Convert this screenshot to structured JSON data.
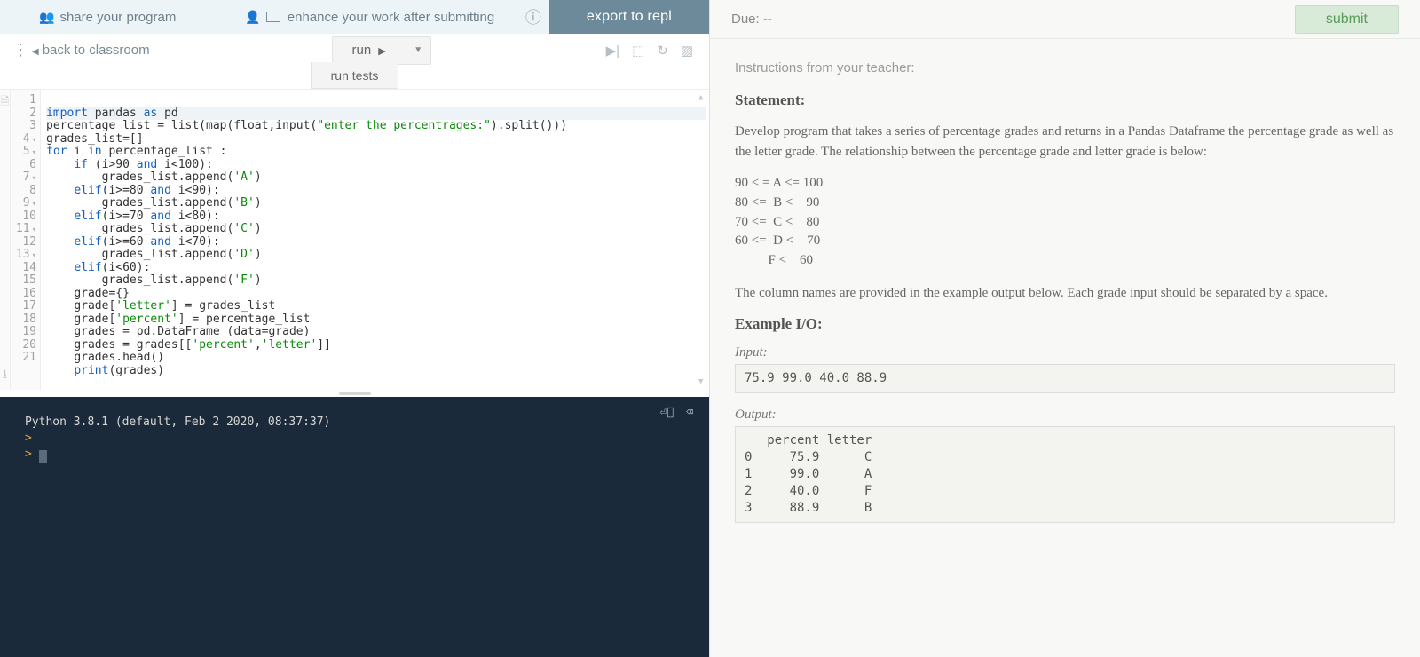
{
  "topstrip": {
    "share": "share your program",
    "enhance": "enhance your work after submitting",
    "export": "export to repl"
  },
  "toolbar": {
    "back": "back to classroom",
    "run": "run",
    "runtests": "run tests"
  },
  "editor": {
    "lines": [
      {
        "n": "1"
      },
      {
        "n": "2"
      },
      {
        "n": "3"
      },
      {
        "n": "4",
        "f": true
      },
      {
        "n": "5",
        "f": true
      },
      {
        "n": "6"
      },
      {
        "n": "7",
        "f": true
      },
      {
        "n": "8"
      },
      {
        "n": "9",
        "f": true
      },
      {
        "n": "10"
      },
      {
        "n": "11",
        "f": true
      },
      {
        "n": "12"
      },
      {
        "n": "13",
        "f": true
      },
      {
        "n": "14"
      },
      {
        "n": "15"
      },
      {
        "n": "16"
      },
      {
        "n": "17"
      },
      {
        "n": "18"
      },
      {
        "n": "19"
      },
      {
        "n": "20"
      },
      {
        "n": "21"
      }
    ]
  },
  "code_tokens": {
    "l1_import": "import",
    "l1_pandas": " pandas ",
    "l1_as": "as",
    "l1_pd": " pd",
    "l2": "percentage_list = list(map(float,input(",
    "l2_str": "\"enter the percentrages:\"",
    "l2_end": ").split()))",
    "l3": "grades_list=[]",
    "l4_for": "for",
    "l4_mid": " i ",
    "l4_in": "in",
    "l4_end": " percentage_list :",
    "l5_if": "if",
    "l5_mid": " (i>90 ",
    "l5_and": "and",
    "l5_end": " i<100):",
    "l6_a": "        grades_list.append(",
    "l6_str": "'A'",
    "l6_b": ")",
    "l7_elif": "elif",
    "l7_mid": "(i>=80 ",
    "l7_and": "and",
    "l7_end": " i<90):",
    "l8_a": "        grades_list.append(",
    "l8_str": "'B'",
    "l8_b": ")",
    "l9_elif": "elif",
    "l9_mid": "(i>=70 ",
    "l9_and": "and",
    "l9_end": " i<80):",
    "l10_a": "        grades_list.append(",
    "l10_str": "'C'",
    "l10_b": ")",
    "l11_elif": "elif",
    "l11_mid": "(i>=60 ",
    "l11_and": "and",
    "l11_end": " i<70):",
    "l12_a": "        grades_list.append(",
    "l12_str": "'D'",
    "l12_b": ")",
    "l13_elif": "elif",
    "l13_end": "(i<60):",
    "l14_a": "        grades_list.append(",
    "l14_str": "'F'",
    "l14_b": ")",
    "l15": "grade={}",
    "l16_a": "grade[",
    "l16_str": "'letter'",
    "l16_b": "] = grades_list",
    "l17_a": "grade[",
    "l17_str": "'percent'",
    "l17_b": "] = percentage_list",
    "l18": "grades = pd.DataFrame (data=grade)",
    "l19_a": "grades = grades[[",
    "l19_s1": "'percent'",
    "l19_c": ",",
    "l19_s2": "'letter'",
    "l19_b": "]]",
    "l20": "grades.head()",
    "l21_print": "print",
    "l21_end": "(grades)"
  },
  "terminal": {
    "line1": "Python 3.8.1 (default, Feb  2 2020, 08:37:37)",
    "prompt": ">"
  },
  "right": {
    "due_label": "Due: ",
    "due_value": "--",
    "submit": "submit",
    "teacher_lbl": "Instructions from your teacher:",
    "h_statement": "Statement:",
    "p_statement": "Develop program that takes a series of percentage grades and returns in a Pandas Dataframe the percentage grade as well as the letter grade. The relationship between the percentage grade and letter grade is below:",
    "grade_lines": "90 < = A <= 100\n80 <=  B <    90\n70 <=  C <    80\n60 <=  D <    70\n          F <    60",
    "p_columns": "The column names are provided in the example output below. Each grade input should be separated by a space.",
    "h_example": "Example I/O:",
    "lbl_input": "Input:",
    "io_input": "75.9 99.0 40.0 88.9",
    "lbl_output": "Output:",
    "io_output": "   percent letter\n0     75.9      C\n1     99.0      A\n2     40.0      F\n3     88.9      B"
  }
}
